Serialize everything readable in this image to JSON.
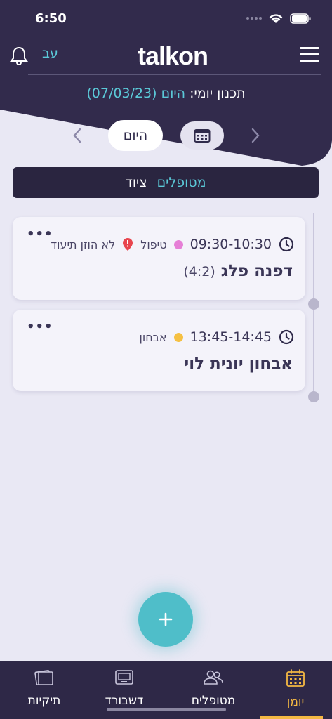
{
  "status_bar": {
    "time": "6:50"
  },
  "header": {
    "logo_text": "talkon",
    "lang_label": "עב",
    "daily_label": "תכנון יומי:",
    "daily_value": "היום (07/03/23)"
  },
  "date_nav": {
    "today_label": "היום"
  },
  "segment": {
    "active": "מטופלים",
    "inactive": "ציוד"
  },
  "appointments": [
    {
      "time": "09:30-10:30",
      "type": "טיפול",
      "type_color": "#e67fd6",
      "warning": "לא הוזן תיעוד",
      "title": "דפנה פלג",
      "subtitle": "(4:2)",
      "more": "•••"
    },
    {
      "time": "13:45-14:45",
      "type": "אבחון",
      "type_color": "#f5c043",
      "title": "אבחון יונית לוי",
      "more": "•••"
    }
  ],
  "fab": {
    "label": "+"
  },
  "tabs": [
    {
      "label": "יומן",
      "icon": "calendar-icon",
      "active": true
    },
    {
      "label": "מטופלים",
      "icon": "users-icon",
      "active": false
    },
    {
      "label": "דשבורד",
      "icon": "dashboard-icon",
      "active": false
    },
    {
      "label": "תיקיות",
      "icon": "folders-icon",
      "active": false
    }
  ],
  "colors": {
    "header_bg": "#322b4c",
    "accent": "#5bc9d8",
    "active_tab": "#f4b843",
    "fab": "#4fbec9"
  }
}
